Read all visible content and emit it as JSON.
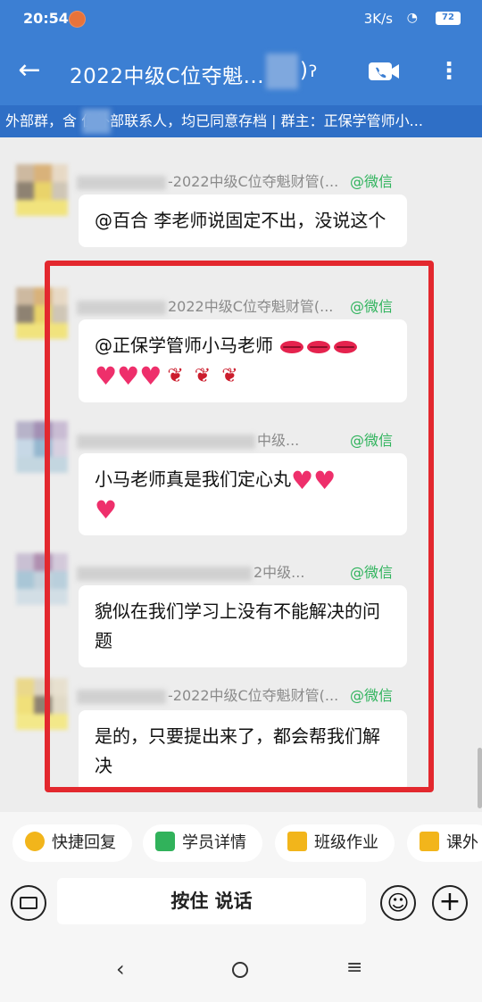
{
  "status_bar": {
    "time": "20:54",
    "network_speed": "3K/s",
    "network_type": "4G",
    "battery": "72"
  },
  "header": {
    "title": "2022中级C位夺魁...",
    "title_suffix": ")",
    "info": "外部群，含   位外部联系人，均已同意存档 | 群主：正保学管师小..."
  },
  "messages": [
    {
      "group_suffix": "-2022中级C位夺魁财管(...",
      "source": "@微信",
      "text": "@百合 李老师说固定不出，没说这个"
    },
    {
      "group_suffix": "2022中级C位夺魁财管(...",
      "source": "@微信",
      "text": "@正保学管师小马老师 "
    },
    {
      "group_suffix": "中级...",
      "source": "@微信",
      "text": "小马老师真是我们定心丸"
    },
    {
      "group_suffix": "2中级...",
      "source": "@微信",
      "text": "貌似在我们学习上没有不能解决的问题"
    },
    {
      "group_suffix": "-2022中级C位夺魁财管(...",
      "source": "@微信",
      "text": "是的，只要提出来了，都会帮我们解决"
    }
  ],
  "quick_actions": [
    {
      "label": "快捷回复",
      "icon": "quick-reply-icon",
      "color": "#f2b51b"
    },
    {
      "label": "学员详情",
      "icon": "student-detail-icon",
      "color": "#31b25b"
    },
    {
      "label": "班级作业",
      "icon": "homework-icon",
      "color": "#f2b51b"
    },
    {
      "label": "课外",
      "icon": "extracurricular-icon",
      "color": "#f2b51b"
    }
  ],
  "input": {
    "talk_label": "按住 说话"
  },
  "colors": {
    "header_blue": "#3c7fd3",
    "highlight_red": "#e3282e",
    "wechat_green": "#2fb35c"
  }
}
